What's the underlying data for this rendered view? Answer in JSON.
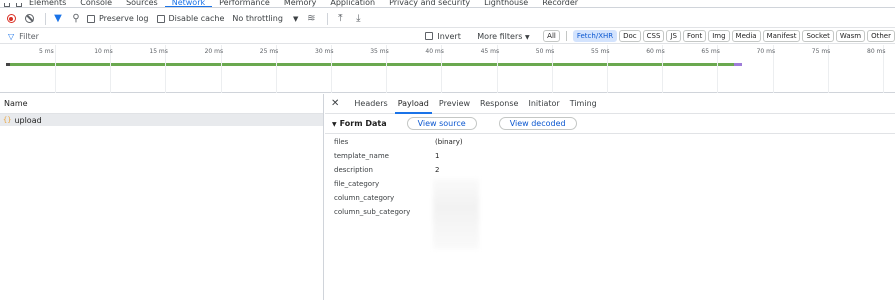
{
  "top_tabs": [
    "Elements",
    "Console",
    "Sources",
    "Network",
    "Performance",
    "Memory",
    "Application",
    "Privacy and security",
    "Lighthouse",
    "Recorder"
  ],
  "top_tabs_active_index": 3,
  "toolbar": {
    "preserve_log": "Preserve log",
    "disable_cache": "Disable cache",
    "throttling": "No throttling"
  },
  "filter": {
    "placeholder": "Filter",
    "invert": "Invert",
    "more_filters": "More filters",
    "chips": [
      "All",
      "Fetch/XHR",
      "Doc",
      "CSS",
      "JS",
      "Font",
      "Img",
      "Media",
      "Manifest",
      "Socket",
      "Wasm",
      "Other"
    ],
    "active_chip": "Fetch/XHR"
  },
  "timeline": {
    "ticks": [
      "5 ms",
      "10 ms",
      "15 ms",
      "20 ms",
      "25 ms",
      "30 ms",
      "35 ms",
      "40 ms",
      "45 ms",
      "50 ms",
      "55 ms",
      "60 ms",
      "65 ms",
      "70 ms",
      "75 ms",
      "80 ms"
    ]
  },
  "requests": {
    "column_name": "Name",
    "rows": [
      {
        "name": "upload"
      }
    ]
  },
  "detail": {
    "tabs": [
      "Headers",
      "Payload",
      "Preview",
      "Response",
      "Initiator",
      "Timing"
    ],
    "active_tab": "Payload",
    "form_data_title": "Form Data",
    "view_source": "View source",
    "view_decoded": "View decoded",
    "fields": [
      {
        "key": "files",
        "value": "(binary)"
      },
      {
        "key": "template_name",
        "value": "1"
      },
      {
        "key": "description",
        "value": "2"
      },
      {
        "key": "file_category",
        "value": ""
      },
      {
        "key": "column_category",
        "value": ""
      },
      {
        "key": "column_sub_category",
        "value": ""
      }
    ]
  },
  "colors": {
    "accent": "#1a73e8",
    "record": "#d93025",
    "waterfall_green": "#6aa84f",
    "waterfall_purple": "#9e7cd8"
  }
}
